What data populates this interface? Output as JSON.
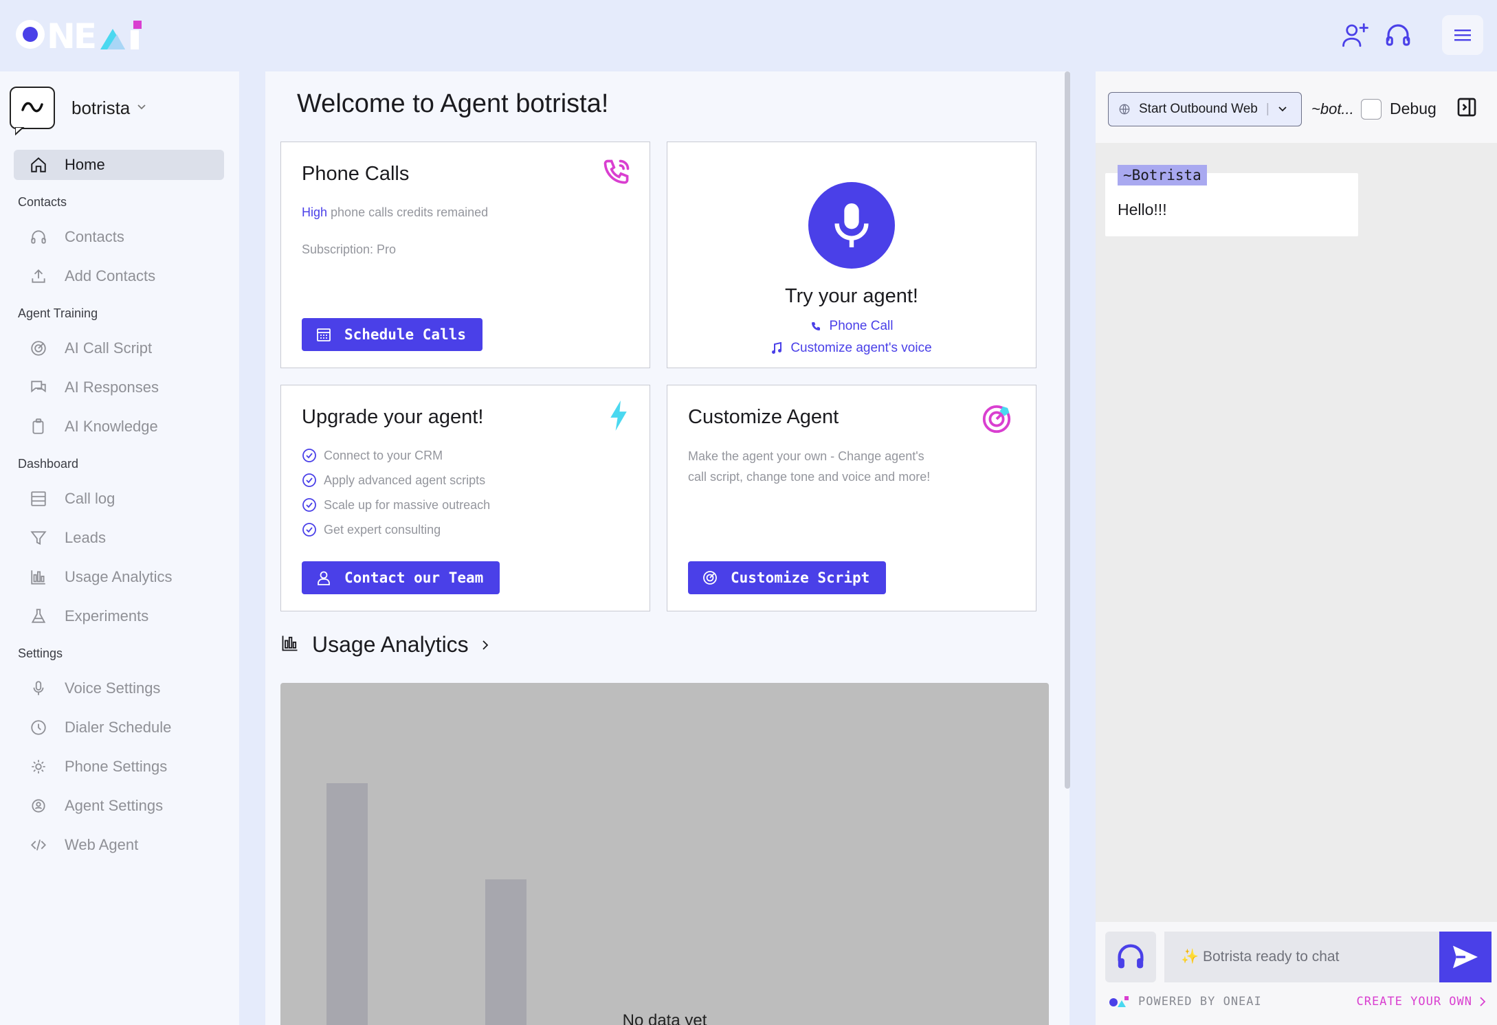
{
  "brand": {
    "logo": "ONEAI",
    "accent": "#4a40e8",
    "pink": "#d93fd0",
    "cyan": "#4ad8f0"
  },
  "header": {
    "icons": [
      "add-user-icon",
      "headset-icon",
      "menu-icon"
    ]
  },
  "sidebar": {
    "agent_name": "botrista",
    "items": [
      {
        "label": "Home",
        "icon": "home-icon",
        "active": true
      }
    ],
    "sections": [
      {
        "title": "Contacts",
        "items": [
          {
            "label": "Contacts",
            "icon": "headset-icon"
          },
          {
            "label": "Add Contacts",
            "icon": "upload-icon"
          }
        ]
      },
      {
        "title": "Agent Training",
        "items": [
          {
            "label": "AI Call Script",
            "icon": "target-icon"
          },
          {
            "label": "AI Responses",
            "icon": "chat-icon"
          },
          {
            "label": "AI Knowledge",
            "icon": "clipboard-icon"
          }
        ]
      },
      {
        "title": "Dashboard",
        "items": [
          {
            "label": "Call log",
            "icon": "table-icon"
          },
          {
            "label": "Leads",
            "icon": "filter-icon"
          },
          {
            "label": "Usage Analytics",
            "icon": "bar-chart-icon"
          },
          {
            "label": "Experiments",
            "icon": "flask-icon"
          }
        ]
      },
      {
        "title": "Settings",
        "items": [
          {
            "label": "Voice Settings",
            "icon": "mic-icon"
          },
          {
            "label": "Dialer Schedule",
            "icon": "clock-icon"
          },
          {
            "label": "Phone Settings",
            "icon": "phone-gear-icon"
          },
          {
            "label": "Agent Settings",
            "icon": "user-gear-icon"
          },
          {
            "label": "Web Agent",
            "icon": "code-icon"
          }
        ]
      }
    ]
  },
  "main": {
    "welcome": "Welcome to Agent botrista!",
    "phone_calls": {
      "title": "Phone Calls",
      "credits_level": "High",
      "credits_text": " phone calls credits remained",
      "subscription": "Subscription: Pro",
      "button": "Schedule Calls"
    },
    "try_agent": {
      "title": "Try your agent!",
      "link_phone": "Phone Call",
      "link_voice": "Customize agent's voice"
    },
    "upgrade": {
      "title": "Upgrade your agent!",
      "features": [
        "Connect to your CRM",
        "Apply advanced agent scripts",
        "Scale up for massive outreach",
        "Get expert consulting"
      ],
      "button": "Contact our Team"
    },
    "customize": {
      "title": "Customize Agent",
      "text_line1": "Make the agent your own - Change agent's",
      "text_line2": "call script, change tone and voice and more!",
      "button": "Customize Script"
    },
    "usage": {
      "title": "Usage Analytics",
      "empty_text": "No data yet"
    }
  },
  "chart_data": {
    "type": "bar",
    "categories": [
      "",
      ""
    ],
    "values": [
      0.72,
      0.45
    ],
    "title": "",
    "xlabel": "",
    "ylabel": ""
  },
  "right_panel": {
    "select_value": "Start Outbound Web",
    "bot_tag": "~bot...",
    "debug_label": "Debug",
    "message_sender": "~Botrista",
    "message_text": "Hello!!!",
    "input_placeholder": "✨ Botrista ready to chat",
    "powered_by": "POWERED BY ONEAI",
    "create_own": "CREATE YOUR OWN"
  }
}
